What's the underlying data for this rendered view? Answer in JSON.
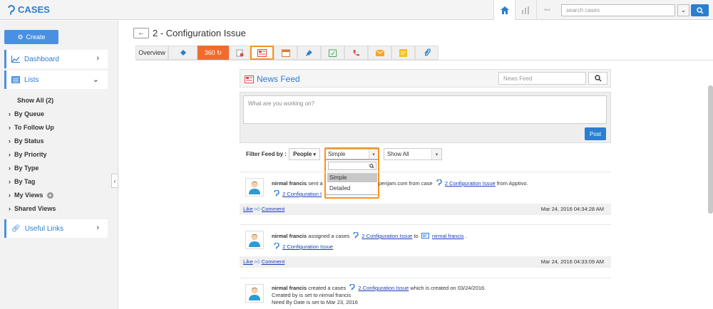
{
  "topbar": {
    "app_title": "CASES",
    "search_placeholder": "search cases"
  },
  "sidebar": {
    "create_label": "Create",
    "dashboard_label": "Dashboard",
    "lists_label": "Lists",
    "list_items": [
      "Show All (2)",
      "By Queue",
      "To Follow Up",
      "By Status",
      "By Priority",
      "By Type",
      "By Tag",
      "My Views",
      "Shared Views"
    ],
    "useful_links_label": "Useful Links"
  },
  "page": {
    "title": "2 - Configuration Issue",
    "tab_overview": "Overview",
    "tab_360": "360"
  },
  "feed": {
    "title": "News Feed",
    "search_placeholder": "News Feed",
    "compose_placeholder": "What are you working on?",
    "post_label": "Post",
    "filter_label": "Filter Feed by :",
    "people_label": "People",
    "type_selected": "Simple",
    "show_selected": "Show All",
    "type_options": [
      "Simple",
      "Detailed"
    ],
    "entries": [
      {
        "user": "nirmal francis",
        "line1_mid": "sent a",
        "line1_hidden": "...",
        "line1_email": "perijam.com from case",
        "case_link": "2 Configuration Issue",
        "line1_end": "from Apptivo.",
        "line2_link": "2 Configuration I",
        "like": "Like",
        "comment": "Comment",
        "time": "Mar 24, 2016 04:34:28 AM"
      },
      {
        "user": "nirmal francis",
        "line1_mid": "assigned a cases",
        "case_link": "2 Configuration Issue",
        "to": "to",
        "assignee": "nirmal francis",
        "line2_link": "2 Configuration Issue",
        "like": "Like",
        "comment": "Comment",
        "time": "Mar 24, 2016 04:33:09 AM"
      },
      {
        "user": "nirmal francis",
        "line1_mid": "created a cases",
        "case_link": "2 Configuration Issue",
        "line1_end": "which is created on 03/24/2016.",
        "line2": "Created by is set to nirmal francis",
        "line3": "Need By Date is set to Mar 23, 2016"
      }
    ]
  },
  "colors": {
    "accent": "#2b7ed1",
    "highlight": "#f7941d",
    "tab_360": "#f26b2d"
  }
}
